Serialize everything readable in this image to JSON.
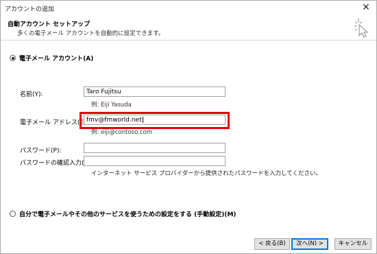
{
  "window": {
    "title": "アカウントの追加",
    "close_glyph": "✕"
  },
  "header": {
    "title": "自動アカウント セットアップ",
    "subtitle": "多くの電子メール アカウントを自動的に設定できます。",
    "icon": "setup-wizard-icon"
  },
  "email_account": {
    "radio_label": "電子メール アカウント(A)",
    "selected": true,
    "name_label": "名前(Y):",
    "name_value": "Taro Fujitsu",
    "name_example": "例: Eiji Yasuda",
    "email_label": "電子メール アドレス(E):",
    "email_value": "fmv@fmworld.net",
    "email_example": "例: eiji@contoso.com",
    "password_label": "パスワード(P):",
    "password_value": "",
    "confirm_label": "パスワードの確認入力(T):",
    "confirm_value": "",
    "password_hint": "インターネット サービス プロバイダーから提供されたパスワードを入力してください。"
  },
  "manual_setup": {
    "radio_label": "自分で電子メールやその他のサービスを使うための設定をする (手動設定)(M)",
    "selected": false
  },
  "buttons": {
    "back": "< 戻る(B)",
    "next": "次へ(N) >",
    "cancel": "キャンセル"
  },
  "highlight_color": "#e00000"
}
